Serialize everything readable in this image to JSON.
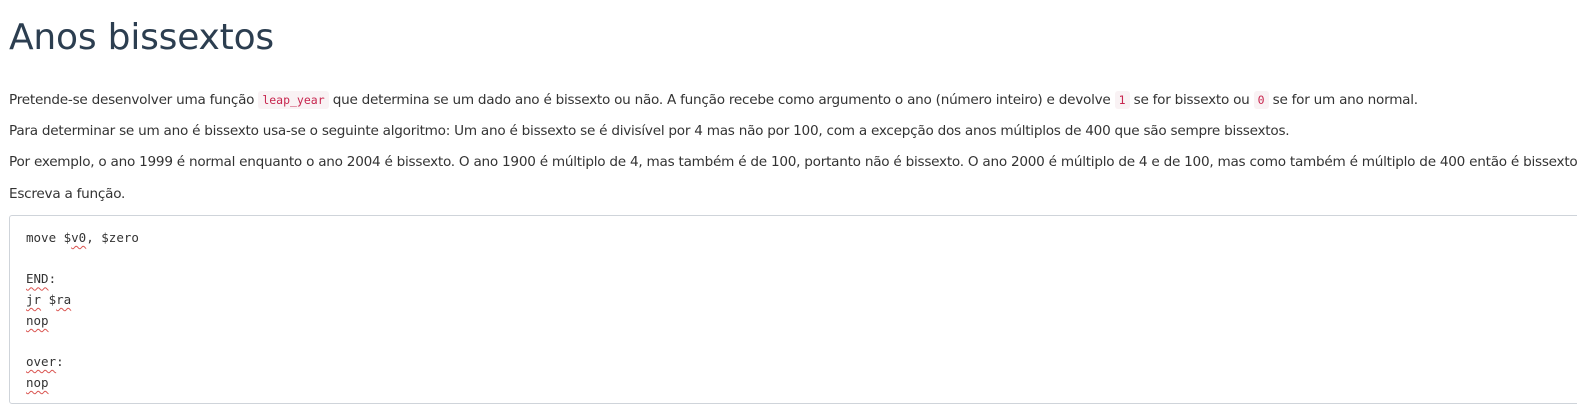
{
  "title": "Anos bissextos",
  "paragraphs": {
    "p1": {
      "before": "Pretende-se desenvolver uma função ",
      "code1": "leap_year",
      "middle": " que determina se um dado ano é bissexto ou não. A função recebe como argumento o ano (número inteiro) e devolve ",
      "code2": "1",
      "middle2": " se for bissexto ou ",
      "code3": "0",
      "after": " se for um ano normal."
    },
    "p2": "Para determinar se um ano é bissexto usa-se o seguinte algoritmo: Um ano é bissexto se é divisível por 4 mas não por 100, com a excepção dos anos múltiplos de 400 que são sempre bissextos.",
    "p3": "Por exemplo, o ano 1999 é normal enquanto o ano 2004 é bissexto. O ano 1900 é múltiplo de 4, mas também é de 100, portanto não é bissexto. O ano 2000 é múltiplo de 4 e de 100, mas como também é múltiplo de 400 então é bissexto.",
    "p4": "Escreva a função."
  },
  "editor": {
    "lines": [
      {
        "a": "move $",
        "b": "v0",
        "c": ", $zero"
      },
      {
        "a": "",
        "b": "",
        "c": ""
      },
      {
        "a": "",
        "b": "END",
        "c": ":"
      },
      {
        "a": "",
        "b": "jr",
        "c": " $",
        "d": "ra"
      },
      {
        "a": "",
        "b": "nop",
        "c": ""
      },
      {
        "a": "",
        "b": "",
        "c": ""
      },
      {
        "a": "",
        "b": "over",
        "c": ":"
      },
      {
        "a": "",
        "b": "nop",
        "c": ""
      }
    ]
  }
}
